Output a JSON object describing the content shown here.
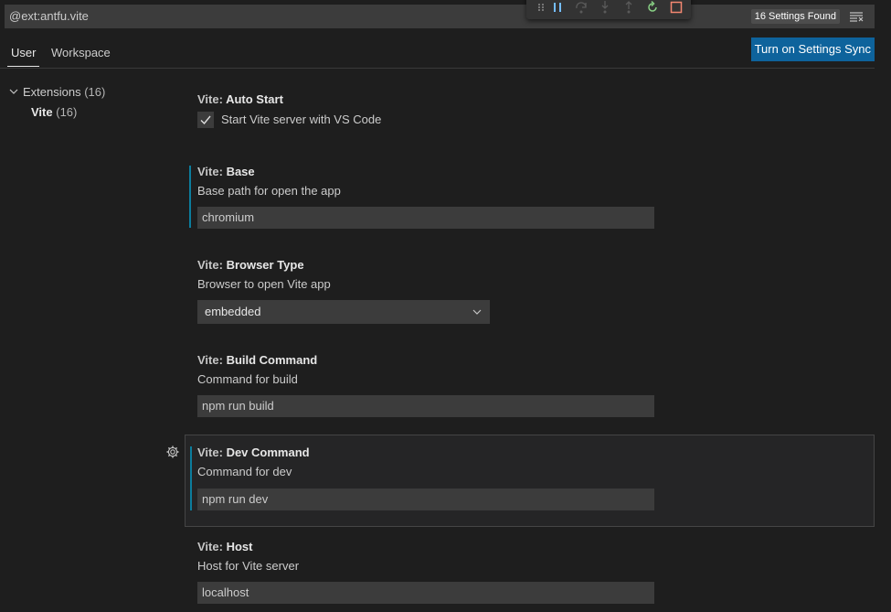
{
  "search": {
    "value": "@ext:antfu.vite",
    "found_count": "16 Settings Found"
  },
  "debug_toolbar": {
    "icons": [
      "drag-handle-icon",
      "pause-icon",
      "step-over-icon",
      "step-into-icon",
      "step-out-icon",
      "restart-icon",
      "stop-icon"
    ]
  },
  "tabs": [
    {
      "label": "User",
      "active": true
    },
    {
      "label": "Workspace",
      "active": false
    }
  ],
  "sync_button": {
    "label": "Turn on Settings Sync"
  },
  "toc": {
    "group_label": "Extensions",
    "group_count": "(16)",
    "item_label": "Vite",
    "item_count": "(16)"
  },
  "settings": {
    "auto_start": {
      "category": "Vite: ",
      "key": "Auto Start",
      "checkbox_label": "Start Vite server with VS Code",
      "checked": true
    },
    "base": {
      "category": "Vite: ",
      "key": "Base",
      "description": "Base path for open the app",
      "value": "chromium"
    },
    "browser_type": {
      "category": "Vite: ",
      "key": "Browser Type",
      "description": "Browser to open Vite app",
      "value": "embedded"
    },
    "build_command": {
      "category": "Vite: ",
      "key": "Build Command",
      "description": "Command for build",
      "value": "npm run build"
    },
    "dev_command": {
      "category": "Vite: ",
      "key": "Dev Command",
      "description": "Command for dev",
      "value": "npm run dev"
    },
    "host": {
      "category": "Vite: ",
      "key": "Host",
      "description": "Host for Vite server",
      "value": "localhost"
    }
  },
  "colors": {
    "accent": "#0e639c",
    "modified_indicator": "#0c7d9d",
    "restart_green": "#89d185",
    "stop_red": "#f48771",
    "pause_blue": "#75beff"
  }
}
